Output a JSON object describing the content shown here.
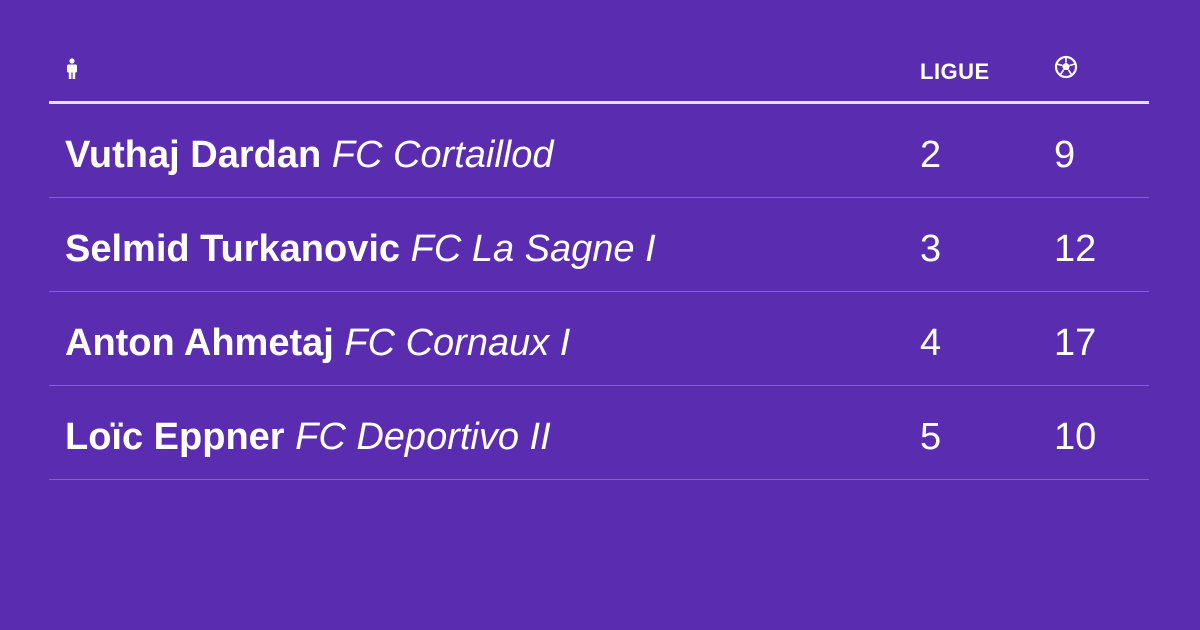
{
  "header": {
    "player_icon": "person-icon",
    "league_label": "LIGUE",
    "goals_icon": "soccer-ball-icon"
  },
  "rows": [
    {
      "name": "Vuthaj Dardan",
      "club": "FC Cortaillod",
      "league": "2",
      "goals": "9"
    },
    {
      "name": "Selmid Turkanovic",
      "club": "FC La Sagne I",
      "league": "3",
      "goals": "12"
    },
    {
      "name": "Anton Ahmetaj",
      "club": "FC Cornaux I",
      "league": "4",
      "goals": "17"
    },
    {
      "name": "Loïc Eppner",
      "club": "FC Deportivo II",
      "league": "5",
      "goals": "10"
    }
  ],
  "colors": {
    "background": "#5a2db0",
    "text": "#ffffff",
    "header_rule": "#e6dff5"
  }
}
